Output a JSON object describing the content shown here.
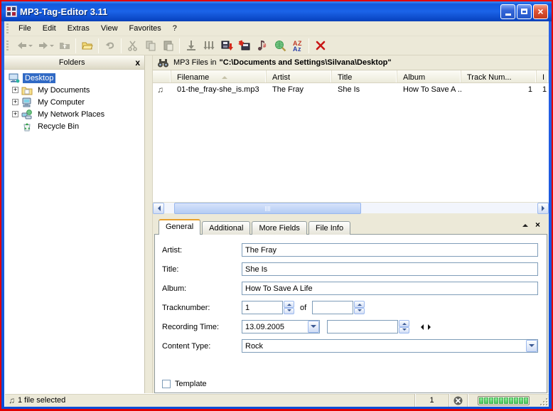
{
  "window": {
    "title": "MP3-Tag-Editor 3.11"
  },
  "menu": {
    "items": [
      "File",
      "Edit",
      "Extras",
      "View",
      "Favorites",
      "?"
    ]
  },
  "toolbar": {
    "buttons": [
      {
        "name": "back",
        "enabled": false
      },
      {
        "name": "forward",
        "enabled": false
      },
      {
        "name": "folder-up",
        "enabled": false
      },
      {
        "name": "open-folder",
        "enabled": true
      },
      {
        "name": "undo",
        "enabled": false
      },
      {
        "name": "cut",
        "enabled": false
      },
      {
        "name": "copy",
        "enabled": false
      },
      {
        "name": "paste",
        "enabled": false
      },
      {
        "name": "save-tag",
        "enabled": true
      },
      {
        "name": "save-all-tags",
        "enabled": true
      },
      {
        "name": "export-disk",
        "enabled": true
      },
      {
        "name": "import-disk",
        "enabled": true
      },
      {
        "name": "renumber-tracks",
        "enabled": true
      },
      {
        "name": "search-web",
        "enabled": true
      },
      {
        "name": "sort-az",
        "enabled": true
      },
      {
        "name": "delete",
        "enabled": true
      }
    ]
  },
  "folders": {
    "title": "Folders",
    "close_glyph": "x",
    "items": [
      {
        "label": "Desktop",
        "selected": true,
        "expandable": false,
        "icon": "desktop-icon"
      },
      {
        "label": "My Documents",
        "selected": false,
        "expandable": true,
        "icon": "my-documents-icon"
      },
      {
        "label": "My Computer",
        "selected": false,
        "expandable": true,
        "icon": "my-computer-icon"
      },
      {
        "label": "My Network Places",
        "selected": false,
        "expandable": true,
        "icon": "network-places-icon"
      },
      {
        "label": "Recycle Bin",
        "selected": false,
        "expandable": false,
        "icon": "recycle-bin-icon"
      }
    ]
  },
  "filelist": {
    "prefix": "MP3 Files in",
    "path": "\"C:\\Documents and Settings\\Silvana\\Desktop\"",
    "columns": [
      "Filename",
      "Artist",
      "Title",
      "Album",
      "Track Num...",
      "I"
    ],
    "row": {
      "filename": "01-the_fray-she_is.mp3",
      "artist": "The Fray",
      "title": "She Is",
      "album": "How To Save A ...",
      "tracknum": "1",
      "extra": "1"
    }
  },
  "tabs": {
    "items": [
      "General",
      "Additional",
      "More Fields",
      "File Info"
    ],
    "active": "General"
  },
  "form": {
    "artist": {
      "label": "Artist:",
      "value": "The Fray"
    },
    "title": {
      "label": "Title:",
      "value": "She Is"
    },
    "album": {
      "label": "Album:",
      "value": "How To Save A Life"
    },
    "tracknumber": {
      "label": "Tracknumber:",
      "value": "1",
      "of_label": "of",
      "of_value": ""
    },
    "recording": {
      "label": "Recording Time:",
      "value": "13.09.2005",
      "second_value": ""
    },
    "content_type": {
      "label": "Content Type:",
      "value": "Rock"
    },
    "template": {
      "label": "Template",
      "checked": false
    }
  },
  "statusbar": {
    "selection": "1 file selected",
    "count": "1",
    "progress": {
      "segments": 10,
      "filled": 10
    }
  },
  "colors": {
    "frame_red": "#e10000",
    "titlebar_blue": "#1259dd",
    "selection_blue": "#316ac5",
    "chrome_beige": "#ece9d8",
    "progress_green": "#4ec95f",
    "tab_accent_orange": "#e7a12e"
  }
}
